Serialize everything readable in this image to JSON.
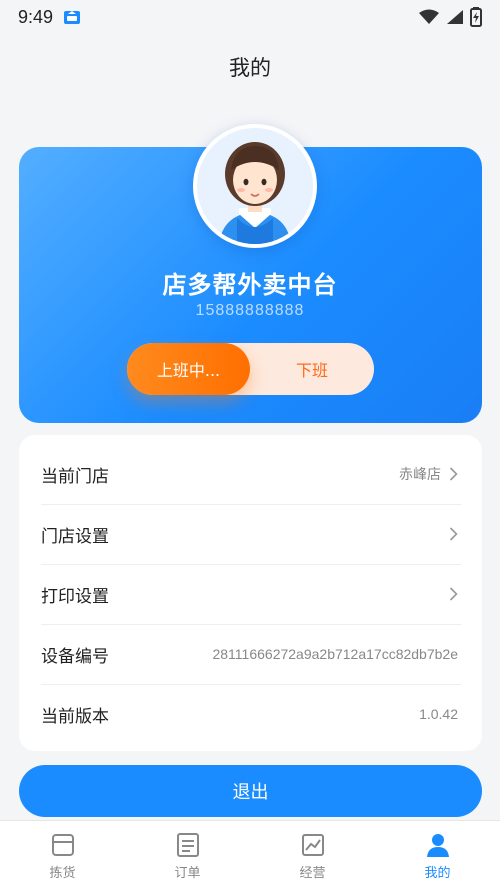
{
  "status_bar": {
    "time": "9:49"
  },
  "header": {
    "title": "我的"
  },
  "profile": {
    "shop_name": "店多帮外卖中台",
    "phone": "15888888888",
    "shift_on_label": "上班中...",
    "shift_off_label": "下班"
  },
  "settings": {
    "items": [
      {
        "label": "当前门店",
        "value": "赤峰店",
        "has_chevron": true
      },
      {
        "label": "门店设置",
        "value": "",
        "has_chevron": true
      },
      {
        "label": "打印设置",
        "value": "",
        "has_chevron": true
      },
      {
        "label": "设备编号",
        "value": "28111666272a9a2b712a17cc82db7b2e",
        "has_chevron": false
      },
      {
        "label": "当前版本",
        "value": "1.0.42",
        "has_chevron": false
      }
    ]
  },
  "logout_label": "退出",
  "nav": {
    "items": [
      {
        "label": "拣货",
        "icon": "package-icon"
      },
      {
        "label": "订单",
        "icon": "order-list-icon"
      },
      {
        "label": "经营",
        "icon": "chart-icon"
      },
      {
        "label": "我的",
        "icon": "user-icon",
        "active": true
      }
    ]
  },
  "colors": {
    "primary": "#1a8cff",
    "accent": "#ff6f00"
  }
}
